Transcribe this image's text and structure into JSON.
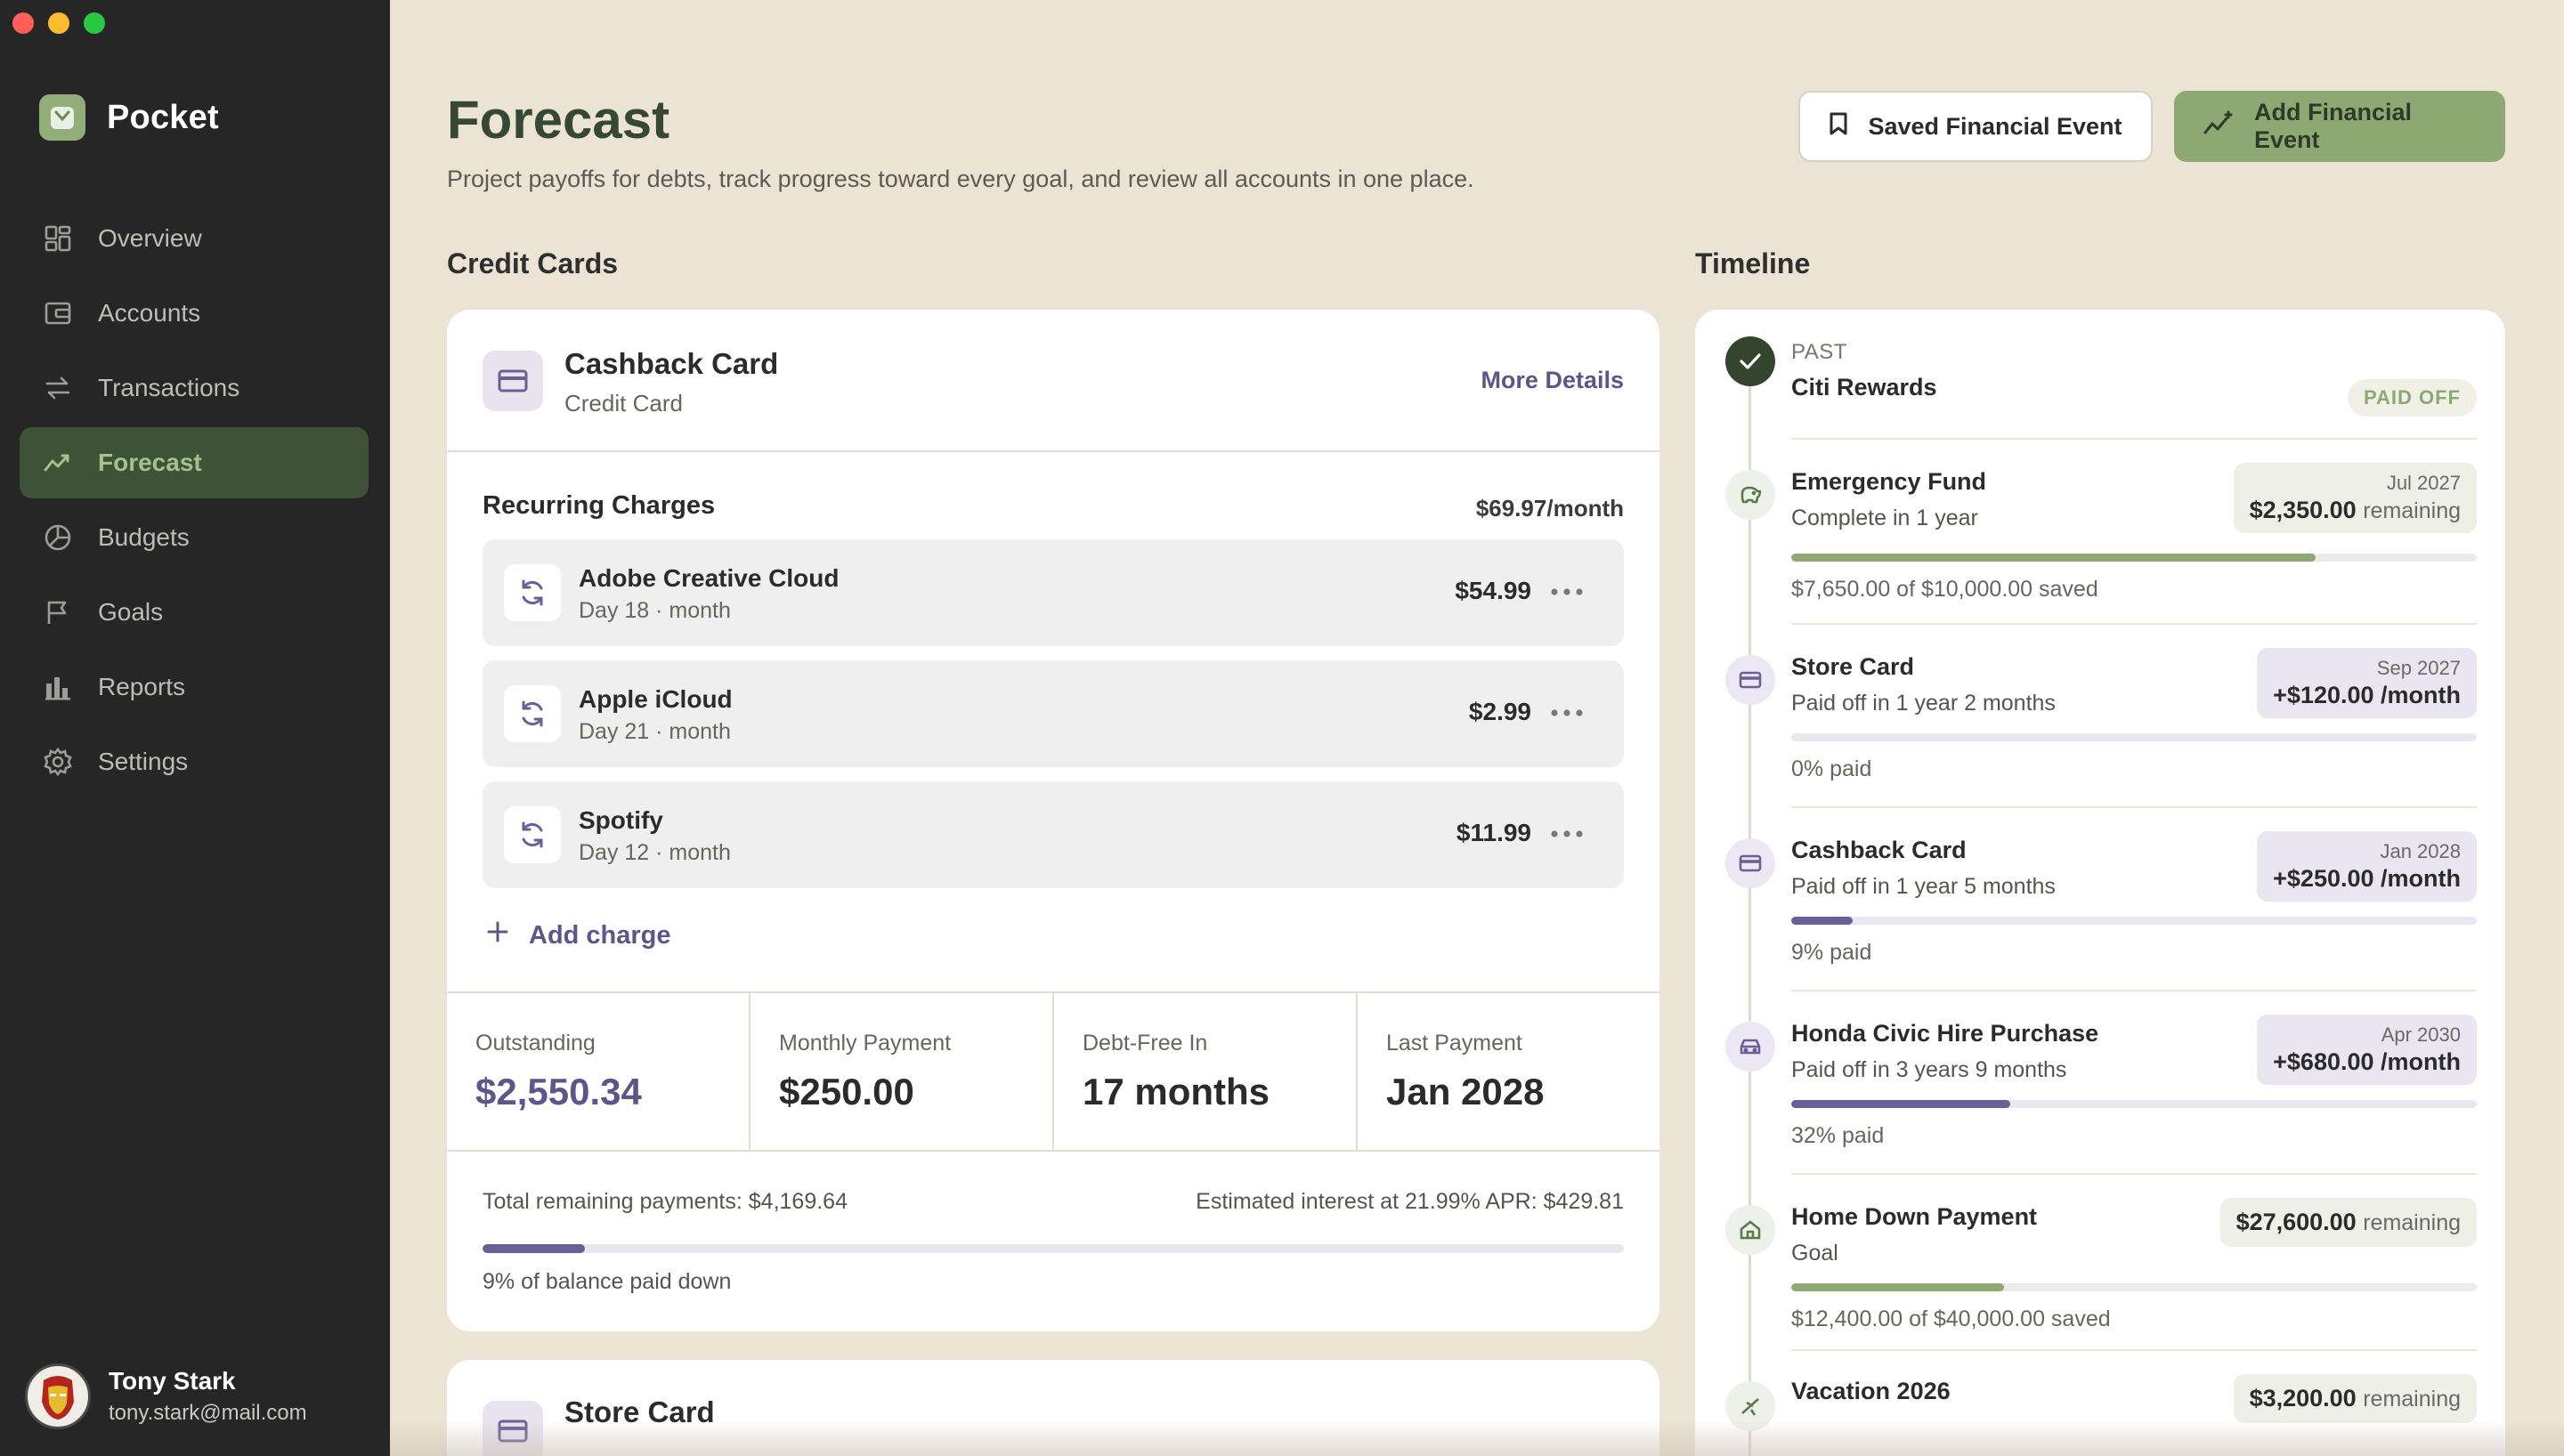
{
  "app": {
    "name": "Pocket"
  },
  "nav": [
    {
      "label": "Overview",
      "icon": "grid-icon",
      "active": false
    },
    {
      "label": "Accounts",
      "icon": "wallet-icon",
      "active": false
    },
    {
      "label": "Transactions",
      "icon": "arrows-icon",
      "active": false
    },
    {
      "label": "Forecast",
      "icon": "trend-icon",
      "active": true
    },
    {
      "label": "Budgets",
      "icon": "pie-icon",
      "active": false
    },
    {
      "label": "Goals",
      "icon": "flag-icon",
      "active": false
    },
    {
      "label": "Reports",
      "icon": "bar-chart-icon",
      "active": false
    },
    {
      "label": "Settings",
      "icon": "gear-icon",
      "active": false
    }
  ],
  "user": {
    "name": "Tony Stark",
    "email": "tony.stark@mail.com"
  },
  "header": {
    "title": "Forecast",
    "subtitle": "Project payoffs for debts, track progress toward every goal, and review all accounts in one place.",
    "saved_button": "Saved Financial Event",
    "add_button": "Add Financial Event"
  },
  "sections": {
    "credit_cards": "Credit Cards",
    "timeline": "Timeline"
  },
  "card": {
    "name": "Cashback Card",
    "type": "Credit Card",
    "more_details": "More Details",
    "recurring_title": "Recurring Charges",
    "recurring_total": "$69.97/month",
    "charges": [
      {
        "name": "Adobe Creative Cloud",
        "day": "Day 18 · month",
        "amount": "$54.99"
      },
      {
        "name": "Apple iCloud",
        "day": "Day 21 · month",
        "amount": "$2.99"
      },
      {
        "name": "Spotify",
        "day": "Day 12 · month",
        "amount": "$11.99"
      }
    ],
    "add_charge": "Add charge",
    "stats": [
      {
        "label": "Outstanding",
        "value": "$2,550.34"
      },
      {
        "label": "Monthly Payment",
        "value": "$250.00"
      },
      {
        "label": "Debt-Free In",
        "value": "17 months"
      },
      {
        "label": "Last Payment",
        "value": "Jan 2028"
      }
    ],
    "total_remaining": "Total remaining payments: $4,169.64",
    "estimated_interest": "Estimated interest at 21.99% APR: $429.81",
    "balance_paid_fraction": 0.09,
    "balance_note": "9% of balance paid down"
  },
  "card2": {
    "name": "Store Card"
  },
  "timeline": {
    "past": {
      "label": "PAST",
      "name": "Citi Rewards",
      "badge": "PAID OFF"
    },
    "items": [
      {
        "name": "Emergency Fund",
        "sub": "Complete in 1 year",
        "date": "Jul 2027",
        "amount": "$2,350.00",
        "suffix": "remaining",
        "progress": 0.765,
        "note": "$7,650.00 of $10,000.00 saved",
        "kind": "goal"
      },
      {
        "name": "Store Card",
        "sub": "Paid off in 1 year 2 months",
        "date": "Sep 2027",
        "amount": "+$120.00 /month",
        "suffix": "",
        "progress": 0.0,
        "note": "0% paid",
        "kind": "debt"
      },
      {
        "name": "Cashback Card",
        "sub": "Paid off in 1 year 5 months",
        "date": "Jan 2028",
        "amount": "+$250.00 /month",
        "suffix": "",
        "progress": 0.09,
        "note": "9% paid",
        "kind": "debt"
      },
      {
        "name": "Honda Civic Hire Purchase",
        "sub": "Paid off in 3 years 9 months",
        "date": "Apr 2030",
        "amount": "+$680.00 /month",
        "suffix": "",
        "progress": 0.32,
        "note": "32% paid",
        "kind": "debt"
      },
      {
        "name": "Home Down Payment",
        "sub": "Goal",
        "date": "",
        "amount": "$27,600.00",
        "suffix": "remaining",
        "progress": 0.31,
        "note": "$12,400.00 of $40,000.00 saved",
        "kind": "goal"
      },
      {
        "name": "Vacation 2026",
        "sub": "",
        "date": "",
        "amount": "$3,200.00",
        "suffix": "remaining",
        "progress": 0,
        "note": "",
        "kind": "goal"
      }
    ]
  }
}
